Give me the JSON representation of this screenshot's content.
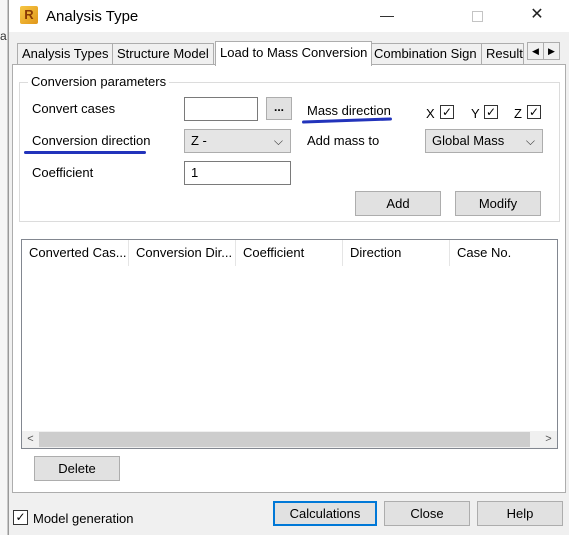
{
  "edge_letter": "a",
  "window": {
    "title": "Analysis Type",
    "app_icon_letter": "R",
    "min_glyph": "—",
    "close_glyph": "✕"
  },
  "tabs": [
    {
      "label": "Analysis Types",
      "active": false
    },
    {
      "label": "Structure Model",
      "active": false
    },
    {
      "label": "Load to Mass Conversion",
      "active": true
    },
    {
      "label": "Combination Sign",
      "active": false
    },
    {
      "label": "Result",
      "active": false
    }
  ],
  "tab_scroll": {
    "left": "◀",
    "right": "▶"
  },
  "conversion": {
    "group_title": "Conversion parameters",
    "convert_cases_label": "Convert cases",
    "convert_cases_value": "",
    "browse_label": "...",
    "mass_direction_label": "Mass direction",
    "mass_directions": [
      {
        "axis": "X",
        "checked": true
      },
      {
        "axis": "Y",
        "checked": true
      },
      {
        "axis": "Z",
        "checked": true
      }
    ],
    "check_glyph": "✓",
    "conversion_direction_label": "Conversion direction",
    "conversion_direction_value": "Z -",
    "add_mass_to_label": "Add mass to",
    "add_mass_to_value": "Global Mass",
    "coefficient_label": "Coefficient",
    "coefficient_value": "1",
    "add_button": "Add",
    "modify_button": "Modify",
    "dropdown_glyph": "⌵"
  },
  "table": {
    "columns": [
      "Converted Cas...",
      "Conversion Dir...",
      "Coefficient",
      "Direction",
      "Case No."
    ],
    "rows": [],
    "scroll_left": "<",
    "scroll_right": ">"
  },
  "delete_button": "Delete",
  "footer": {
    "model_generation_label": "Model generation",
    "model_generation_checked": true,
    "calculations_button": "Calculations",
    "close_button": "Close",
    "help_button": "Help"
  },
  "colors": {
    "annotation_underline": "#2233bb",
    "default_button_border": "#0078d7"
  }
}
